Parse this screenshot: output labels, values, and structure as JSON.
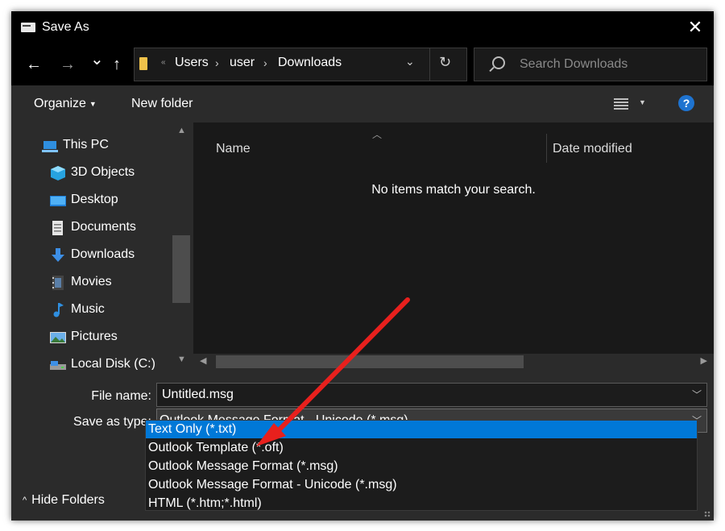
{
  "window": {
    "title": "Save As",
    "close_symbol": "✕"
  },
  "nav": {
    "back": "←",
    "forward": "→",
    "recent": "⌄",
    "up": "↑",
    "breadcrumb_overflow": "«",
    "breadcrumb": [
      "Users",
      "user",
      "Downloads"
    ],
    "breadcrumb_separator": "›",
    "address_dropdown": "⌄",
    "refresh": "↻",
    "search_placeholder": "Search Downloads"
  },
  "toolbar": {
    "organize": "Organize",
    "new_folder": "New folder",
    "help": "?"
  },
  "nav_pane": {
    "items": [
      {
        "label": "This PC",
        "icon": "computer-icon"
      },
      {
        "label": "3D Objects",
        "icon": "3d-objects-icon"
      },
      {
        "label": "Desktop",
        "icon": "desktop-icon"
      },
      {
        "label": "Documents",
        "icon": "documents-icon"
      },
      {
        "label": "Downloads",
        "icon": "downloads-icon"
      },
      {
        "label": "Movies",
        "icon": "movies-icon"
      },
      {
        "label": "Music",
        "icon": "music-icon"
      },
      {
        "label": "Pictures",
        "icon": "pictures-icon"
      },
      {
        "label": "Local Disk (C:)",
        "icon": "disk-icon"
      }
    ]
  },
  "file_list": {
    "columns": [
      "Name",
      "Date modified"
    ],
    "empty_message": "No items match your search."
  },
  "form": {
    "file_name_label": "File name:",
    "file_name_value": "Untitled.msg",
    "save_type_label": "Save as type:",
    "save_type_value": "Outlook Message Format - Unicode (*.msg)",
    "options": [
      "Text Only (*.txt)",
      "Outlook Template (*.oft)",
      "Outlook Message Format (*.msg)",
      "Outlook Message Format - Unicode (*.msg)",
      "HTML (*.htm;*.html)"
    ],
    "selected_option": 0
  },
  "footer": {
    "hide_folders": "Hide Folders"
  },
  "colors": {
    "accent": "#0078d7",
    "annotation_arrow": "#e8201d",
    "help_icon": "#1e73d0"
  }
}
